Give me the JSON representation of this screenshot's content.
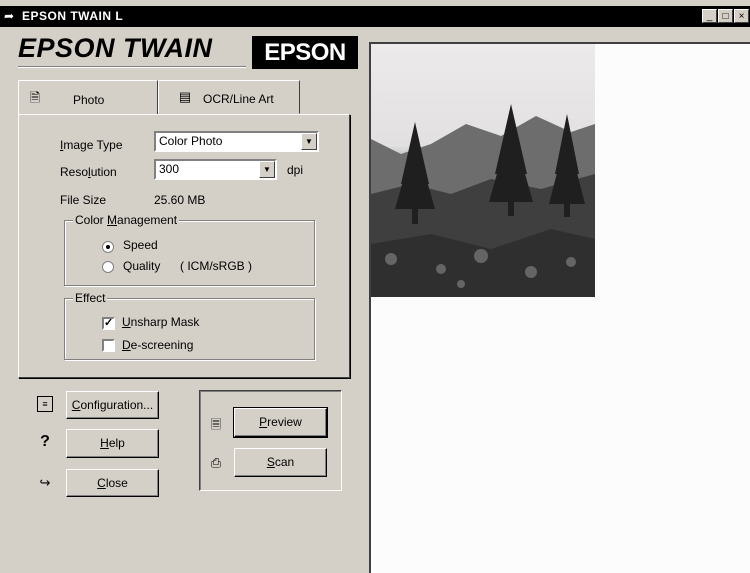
{
  "window": {
    "title": "EPSON TWAIN L",
    "controls": {
      "minimize": "_",
      "maximize": "□",
      "close": "×"
    }
  },
  "brand": {
    "product": "EPSON TWAIN",
    "logo": "EPSON"
  },
  "tabs": [
    {
      "label": "Photo",
      "icon": "photo-icon",
      "active": true
    },
    {
      "label": "OCR/Line Art",
      "icon": "ocr-icon",
      "active": false
    }
  ],
  "photo": {
    "image_type": {
      "label_pre": "",
      "label_key": "I",
      "label_post": "mage Type",
      "value": "Color Photo"
    },
    "resolution": {
      "label_pre": "Reso",
      "label_key": "l",
      "label_post": "ution",
      "value": "300",
      "unit": "dpi"
    },
    "file_size": {
      "label": "File Size",
      "value": "25.60 MB"
    },
    "color_management": {
      "title_pre": "Color ",
      "title_key": "M",
      "title_post": "anagement",
      "options": [
        {
          "label": "Speed",
          "extra": "",
          "selected": true
        },
        {
          "label": "Quality",
          "extra": "( ICM/sRGB )",
          "selected": false
        }
      ]
    },
    "effect": {
      "title": "Effect",
      "options": [
        {
          "label_pre": "",
          "label_key": "U",
          "label_post": "nsharp Mask",
          "checked": true
        },
        {
          "label_pre": "",
          "label_key": "D",
          "label_post": "e-screening",
          "checked": false
        }
      ]
    }
  },
  "left_buttons": [
    {
      "label_pre": "",
      "label_key": "C",
      "label_post": "onfiguration...",
      "icon": "configuration-icon"
    },
    {
      "label_pre": "",
      "label_key": "H",
      "label_post": "elp",
      "icon": "help-icon"
    },
    {
      "label_pre": "",
      "label_key": "C",
      "label_post": "lose",
      "icon": "close-door-icon"
    }
  ],
  "action_buttons": [
    {
      "label_pre": "",
      "label_key": "P",
      "label_post": "review",
      "icon": "document-icon"
    },
    {
      "label_pre": "",
      "label_key": "S",
      "label_post": "can",
      "icon": "scanner-icon"
    }
  ],
  "colors": {
    "face": "#d4d0c8",
    "titlebar": "#000000",
    "preview_bg": "#fcfcfc"
  }
}
